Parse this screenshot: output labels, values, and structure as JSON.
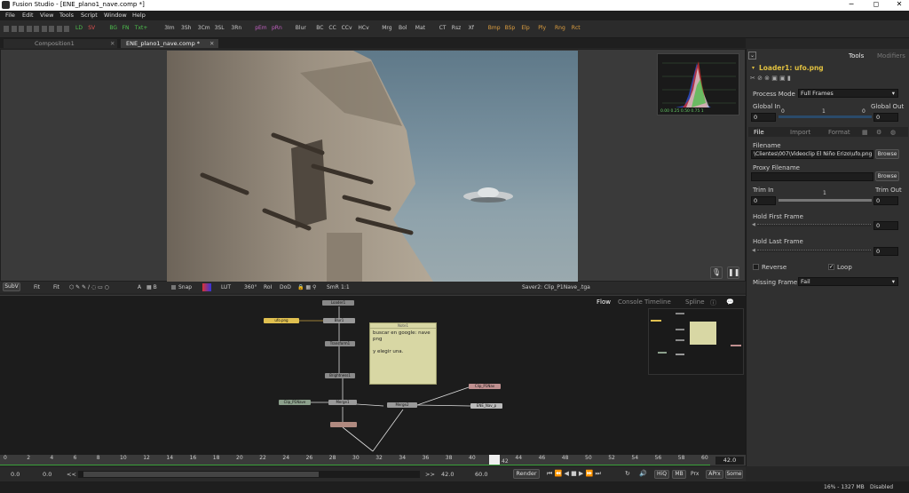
{
  "window": {
    "title": "Fusion Studio - [ENE_plano1_nave.comp *]",
    "min": "−",
    "max": "◻",
    "close": "✕"
  },
  "menu": [
    "File",
    "Edit",
    "View",
    "Tools",
    "Script",
    "Window",
    "Help"
  ],
  "toolbar": [
    {
      "label": "LD",
      "color": "#4ec04e"
    },
    {
      "label": "SV",
      "color": "#e05050"
    },
    {
      "label": "BG",
      "color": "#4ec04e"
    },
    {
      "label": "FN",
      "color": "#4ec04e"
    },
    {
      "label": "Txt+",
      "color": "#4ec04e"
    },
    {
      "label": "3Im",
      "color": "#c9c9c9"
    },
    {
      "label": "3Sh",
      "color": "#c9c9c9"
    },
    {
      "label": "3Cm",
      "color": "#c9c9c9"
    },
    {
      "label": "3SL",
      "color": "#c9c9c9"
    },
    {
      "label": "3Rn",
      "color": "#c9c9c9"
    },
    {
      "label": "pEm",
      "color": "#c060c0"
    },
    {
      "label": "pRn",
      "color": "#c060c0"
    },
    {
      "label": "Blur",
      "color": "#c9c9c9"
    },
    {
      "label": "BC",
      "color": "#c9c9c9"
    },
    {
      "label": "CC",
      "color": "#c9c9c9"
    },
    {
      "label": "CCv",
      "color": "#c9c9c9"
    },
    {
      "label": "HCv",
      "color": "#c9c9c9"
    },
    {
      "label": "Mrg",
      "color": "#c9c9c9"
    },
    {
      "label": "Bol",
      "color": "#c9c9c9"
    },
    {
      "label": "Mat",
      "color": "#c9c9c9"
    },
    {
      "label": "CT",
      "color": "#c9c9c9"
    },
    {
      "label": "Rsz",
      "color": "#c9c9c9"
    },
    {
      "label": "Xf",
      "color": "#c9c9c9"
    },
    {
      "label": "Bmp",
      "color": "#e0a040"
    },
    {
      "label": "BSp",
      "color": "#e0a040"
    },
    {
      "label": "Elp",
      "color": "#e0a040"
    },
    {
      "label": "Ply",
      "color": "#e0a040"
    },
    {
      "label": "Rng",
      "color": "#e0a040"
    },
    {
      "label": "Rct",
      "color": "#e0a040"
    }
  ],
  "tabs": {
    "comp1": "Composition1",
    "comp2": "ENE_plano1_nave.comp *"
  },
  "viewerbar": {
    "subv": "SubV",
    "fit1": "Fit",
    "fit2": "Fit",
    "snap": "Snap",
    "lut": "LUT",
    "r360": "360°",
    "roi": "RoI",
    "dod": "DoD",
    "smr": "SmR",
    "ratio": "1:1",
    "saver": "Saver2: Clip_P1Nave_.tga"
  },
  "histogram": {
    "labels": "0.00  0.25  0.50  0.75  1"
  },
  "flow_tabs": [
    "Flow",
    "Console",
    "Timeline",
    "Spline"
  ],
  "flow": {
    "note_title": "Note1",
    "note_line1": "buscar en google: nave",
    "note_line2": "png",
    "note_line3": "y elegir una.",
    "nodes": {
      "loader": "Loader1",
      "ufo": "ufo.png",
      "blur": "Blur1",
      "transform": "Transform1",
      "bright": "Brightness1",
      "clip": "Clip_P1Nave",
      "merge1": "Merge1",
      "merge2": "Merge2",
      "saver": "Clip_P1Nav",
      "out": "ENE_Nav_p"
    }
  },
  "timeline": {
    "ticks": [
      "0",
      "2",
      "4",
      "6",
      "8",
      "10",
      "12",
      "14",
      "16",
      "18",
      "20",
      "22",
      "24",
      "26",
      "28",
      "30",
      "32",
      "34",
      "36",
      "38",
      "40",
      "42",
      "44",
      "46",
      "48",
      "50",
      "52",
      "54",
      "56",
      "58",
      "60"
    ],
    "current_frame": "42",
    "end": "42.0"
  },
  "controls": {
    "start": "0.0",
    "render_start": "0.0",
    "rw": "<<",
    "ff": ">>",
    "render_end": "42.0",
    "end": "60.0",
    "render": "Render",
    "hiq": "HiQ",
    "mb": "MB",
    "prx": "Prx",
    "aprx": "APrx",
    "some": "Some"
  },
  "status": {
    "mem": "16% - 1327 MB",
    "state": "Disabled"
  },
  "rpanel": {
    "tab_tools": "Tools",
    "tab_modifiers": "Modifiers",
    "loader_title": "Loader1: ufo.png",
    "process_mode_label": "Process Mode",
    "process_mode_value": "Full Frames",
    "global_in_label": "Global In",
    "global_out_label": "Global Out",
    "global_in_value": "0",
    "global_out_value": "0",
    "scale_0": "0",
    "scale_1": "1",
    "scale_0b": "0",
    "subtab_file": "File",
    "subtab_import": "Import",
    "subtab_format": "Format",
    "filename_label": "Filename",
    "filename_value": "\\Clientes\\007\\Videoclip El Niño Erizo\\ufo.png",
    "browse": "Browse",
    "proxy_label": "Proxy Filename",
    "proxy_value": "",
    "trim_in_label": "Trim In",
    "trim_out_label": "Trim Out",
    "trim_in_value": "0",
    "trim_out_value": "0",
    "trim_mid": "1",
    "hold_first_label": "Hold First Frame",
    "hold_first_value": "0",
    "hold_last_label": "Hold Last Frame",
    "hold_last_value": "0",
    "reverse": "Reverse",
    "loop": "Loop",
    "missing_label": "Missing Frame",
    "missing_value": "Fail"
  }
}
